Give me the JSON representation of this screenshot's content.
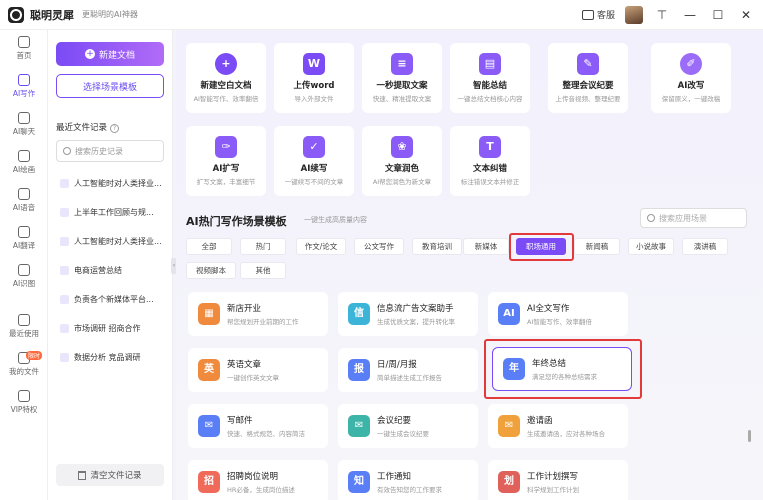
{
  "app": {
    "name": "聪明灵犀",
    "slogan": "更聪明的AI神器",
    "customer_service": "客服"
  },
  "window_controls": {
    "pin": "⊤",
    "minimize": "—",
    "maximize": "☐",
    "close": "✕"
  },
  "leftnav": {
    "items": [
      {
        "label": "首页",
        "icon": "home-icon"
      },
      {
        "label": "AI写作",
        "icon": "pen-icon",
        "active": true
      },
      {
        "label": "AI聊天",
        "icon": "chat-icon"
      },
      {
        "label": "AI绘画",
        "icon": "brush-icon"
      },
      {
        "label": "AI语音",
        "icon": "mic-icon"
      },
      {
        "label": "AI翻译",
        "icon": "translate-icon"
      },
      {
        "label": "AI识图",
        "icon": "scan-icon"
      },
      {
        "label": "最近使用",
        "icon": "clock-icon"
      },
      {
        "label": "我的文件",
        "icon": "file-icon"
      },
      {
        "label": "VIP特权",
        "icon": "diamond-icon"
      }
    ],
    "vip_badge": "限时"
  },
  "midpanel": {
    "new_doc": "新建文档",
    "choose_template": "选择场景模板",
    "recent_title": "最近文件记录",
    "search_placeholder": "搜索历史记录",
    "recent": [
      "人工智能时对人类择业...",
      "上半年工作回顾与规...",
      "人工智能时对人类择业...",
      "电商运营总结",
      "负责各个新媒体平台...",
      "市场调研 招商合作",
      "数据分析 竞品调研"
    ],
    "clear": "清空文件记录"
  },
  "quick_cards": [
    {
      "title": "新建空白文档",
      "desc": "AI智能写作、效率翻倍",
      "color": "#7b4bf5",
      "glyph": "+"
    },
    {
      "title": "上传word",
      "desc": "导入外部文件",
      "color": "#7b4bf5",
      "glyph": "W"
    },
    {
      "title": "一秒提取文案",
      "desc": "快速、精准提取文案",
      "color": "#8a5bf6",
      "glyph": "≡"
    },
    {
      "title": "智能总结",
      "desc": "一键总结文档核心内容",
      "color": "#8a5bf6",
      "glyph": "▤"
    },
    {
      "title": "整理会议纪要",
      "desc": "上传音视频、整理纪要",
      "color": "#8a5bf6",
      "glyph": "✎"
    },
    {
      "title": "AI改写",
      "desc": "保留原义，一键改稿",
      "color": "#9b6cf7",
      "glyph": "✐"
    },
    {
      "title": "AI扩写",
      "desc": "扩写文案，丰富细节",
      "color": "#8a5bf6",
      "glyph": "✑"
    },
    {
      "title": "AI续写",
      "desc": "一键续写不间的文章",
      "color": "#8a5bf6",
      "glyph": "✓"
    },
    {
      "title": "文章润色",
      "desc": "AI帮您润色为新文章",
      "color": "#8a5bf6",
      "glyph": "❀"
    },
    {
      "title": "文本纠错",
      "desc": "标注错误文本并修正",
      "color": "#8a5bf6",
      "glyph": "T"
    }
  ],
  "section": {
    "title": "AI热门写作场景模板",
    "subtitle": "一键生成高质量内容",
    "search_placeholder": "搜索应用场景"
  },
  "tags": [
    "全部",
    "热门",
    "作文/论文",
    "公文写作",
    "教育培训",
    "新媒体",
    "职场通用",
    "新闻稿",
    "小说故事",
    "演讲稿",
    "视频脚本",
    "其他"
  ],
  "active_tag": "职场通用",
  "templates": [
    {
      "title": "新店开业",
      "desc": "帮您规划开业前期的工作",
      "color": "#f08a3c",
      "glyph": "▦"
    },
    {
      "title": "信息流广告文案助手",
      "desc": "生成优质文案，提升转化率",
      "color": "#3cb4d8",
      "glyph": "信"
    },
    {
      "title": "AI全文写作",
      "desc": "AI智能写作、效率翻倍",
      "color": "#5a7ef5",
      "glyph": "AI"
    },
    {
      "title": "英语文章",
      "desc": "一键创作英文文章",
      "color": "#f08a3c",
      "glyph": "英"
    },
    {
      "title": "日/周/月报",
      "desc": "简单描述生成工作报告",
      "color": "#5a7ef5",
      "glyph": "报"
    },
    {
      "title": "年终总结",
      "desc": "满足您的各种总结需求",
      "color": "#5a7ef5",
      "glyph": "年"
    },
    {
      "title": "写邮件",
      "desc": "快速、格式规范、内容简洁",
      "color": "#5a7ef5",
      "glyph": "✉"
    },
    {
      "title": "会议纪要",
      "desc": "一键生成会议纪要",
      "color": "#3cb4a8",
      "glyph": "✉"
    },
    {
      "title": "邀请函",
      "desc": "生成邀请函，应对各种场合",
      "color": "#f0a13c",
      "glyph": "✉"
    },
    {
      "title": "招聘岗位说明",
      "desc": "HR必备，生成岗位描述",
      "color": "#f06a5a",
      "glyph": "招"
    },
    {
      "title": "工作通知",
      "desc": "有效告知您的工作要求",
      "color": "#5a7ef5",
      "glyph": "知"
    },
    {
      "title": "工作计划撰写",
      "desc": "科学规划工作计划",
      "color": "#e0605a",
      "glyph": "划"
    }
  ],
  "selected_template": "年终总结",
  "highlight_color": "#e23a3a",
  "accent": "#7b4bf5"
}
